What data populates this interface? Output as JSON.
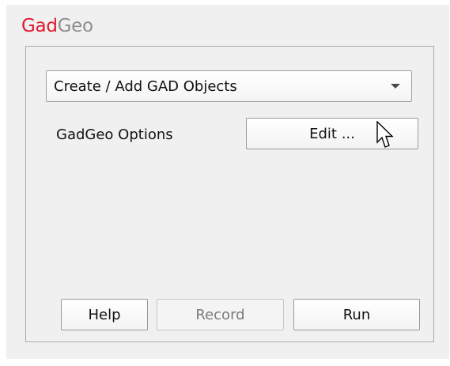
{
  "app": {
    "title_part1": "Gad",
    "title_part2": "Geo",
    "title_color_part1": "#e3182d",
    "title_color_part2": "#8f8f8f"
  },
  "dropdown": {
    "selected": "Create / Add GAD Objects"
  },
  "options": {
    "label": "GadGeo Options",
    "edit_button": "Edit ..."
  },
  "buttons": {
    "help": "Help",
    "record": "Record",
    "run": "Run",
    "record_enabled": false
  },
  "icons": {
    "dropdown_arrow": "chevron-down-icon",
    "cursor": "mouse-pointer-icon"
  }
}
